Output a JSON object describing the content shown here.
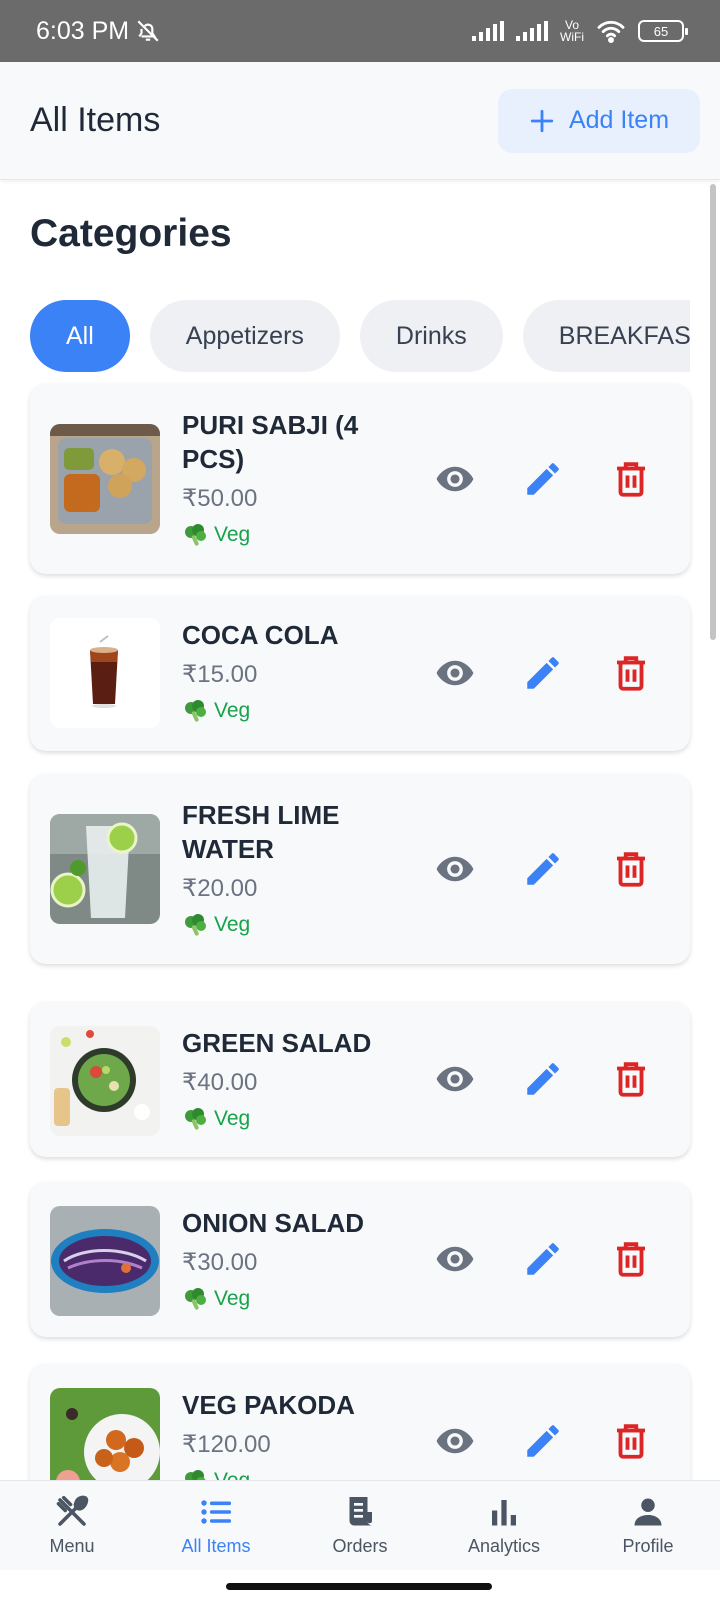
{
  "status_bar": {
    "time": "6:03 PM",
    "vowifi_top": "Vo",
    "vowifi_bottom": "WiFi",
    "battery": "65"
  },
  "header": {
    "title": "All Items",
    "add_label": "Add Item"
  },
  "categories": {
    "title": "Categories",
    "chips": [
      "All",
      "Appetizers",
      "Drinks",
      "BREAKFAST"
    ]
  },
  "items": [
    {
      "name": "PURI SABJI (4 PCS)",
      "price": "₹50.00",
      "type": "Veg"
    },
    {
      "name": "COCA COLA",
      "price": "₹15.00",
      "type": "Veg"
    },
    {
      "name": "FRESH LIME WATER",
      "price": "₹20.00",
      "type": "Veg"
    },
    {
      "name": "GREEN SALAD",
      "price": "₹40.00",
      "type": "Veg"
    },
    {
      "name": "ONION SALAD",
      "price": "₹30.00",
      "type": "Veg"
    },
    {
      "name": "VEG PAKODA",
      "price": "₹120.00",
      "type": "Veg"
    }
  ],
  "bottom_nav": [
    {
      "label": "Menu",
      "icon": "fork-knife-icon"
    },
    {
      "label": "All Items",
      "icon": "list-icon"
    },
    {
      "label": "Orders",
      "icon": "receipt-icon"
    },
    {
      "label": "Analytics",
      "icon": "bar-chart-icon"
    },
    {
      "label": "Profile",
      "icon": "person-icon"
    }
  ],
  "colors": {
    "accent": "#3b82f6",
    "veg": "#16a34a",
    "delete": "#dc2626",
    "view": "#6b7280"
  }
}
